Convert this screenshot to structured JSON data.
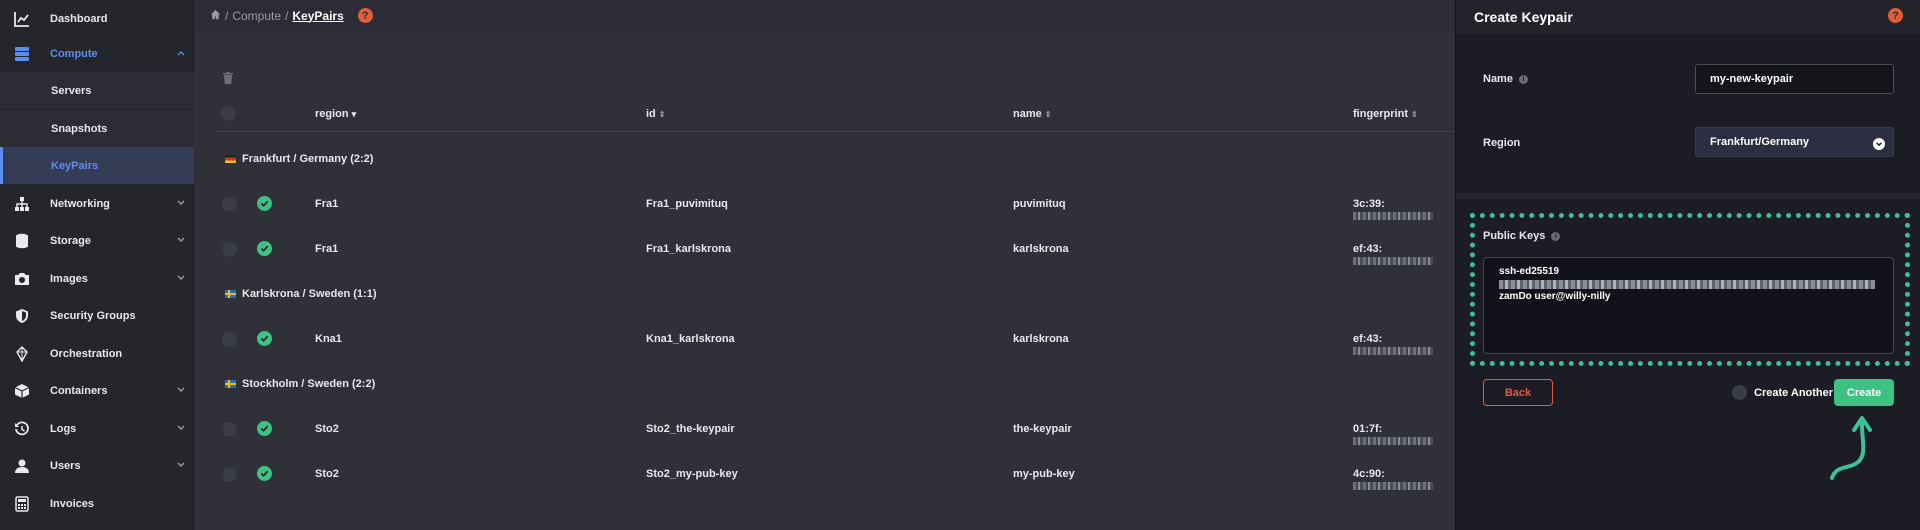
{
  "sidebar": {
    "items": [
      {
        "label": "Dashboard",
        "icon": "chart-icon"
      },
      {
        "label": "Compute",
        "icon": "server-stack-icon",
        "expanded": true
      },
      {
        "label": "Networking",
        "icon": "network-icon"
      },
      {
        "label": "Storage",
        "icon": "database-icon"
      },
      {
        "label": "Images",
        "icon": "camera-icon"
      },
      {
        "label": "Security Groups",
        "icon": "shield-icon"
      },
      {
        "label": "Orchestration",
        "icon": "orchestration-icon"
      },
      {
        "label": "Containers",
        "icon": "box-icon"
      },
      {
        "label": "Logs",
        "icon": "history-icon"
      },
      {
        "label": "Users",
        "icon": "user-icon"
      },
      {
        "label": "Invoices",
        "icon": "calculator-icon"
      }
    ],
    "compute_sub": [
      "Servers",
      "Snapshots",
      "KeyPairs"
    ]
  },
  "breadcrumb": {
    "sep1": "/",
    "section": "Compute",
    "sep2": "/",
    "current": "KeyPairs"
  },
  "table": {
    "columns": [
      "region",
      "id",
      "name",
      "fingerprint"
    ],
    "groups": [
      {
        "title": "Frankfurt / Germany (2:2)",
        "flag": "de"
      },
      {
        "title": "Karlskrona / Sweden (1:1)",
        "flag": "se"
      },
      {
        "title": "Stockholm / Sweden (2:2)",
        "flag": "se"
      }
    ],
    "rows": [
      {
        "region": "Fra1",
        "id": "Fra1_puvimituq",
        "name": "puvimituq",
        "fingerprint_prefix": "3c:39:"
      },
      {
        "region": "Fra1",
        "id": "Fra1_karlskrona",
        "name": "karlskrona",
        "fingerprint_prefix": "ef:43:"
      },
      {
        "region": "Kna1",
        "id": "Kna1_karlskrona",
        "name": "karlskrona",
        "fingerprint_prefix": "ef:43:"
      },
      {
        "region": "Sto2",
        "id": "Sto2_the-keypair",
        "name": "the-keypair",
        "fingerprint_prefix": "01:7f:"
      },
      {
        "region": "Sto2",
        "id": "Sto2_my-pub-key",
        "name": "my-pub-key",
        "fingerprint_prefix": "4c:90:"
      }
    ]
  },
  "panel": {
    "title": "Create Keypair",
    "name_label": "Name",
    "name_value": "my-new-keypair",
    "region_label": "Region",
    "region_value": "Frankfurt/Germany",
    "public_keys_label": "Public Keys",
    "public_key_line1": "ssh-ed25519",
    "public_key_line3": "zamDo user@willy-nilly",
    "back_label": "Back",
    "create_another_label": "Create Another",
    "create_label": "Create"
  },
  "colors": {
    "accent": "#5b8ef0",
    "success": "#3ec283",
    "danger": "#e55a45",
    "highlight": "#3dbf97",
    "help": "#e35d3b"
  }
}
